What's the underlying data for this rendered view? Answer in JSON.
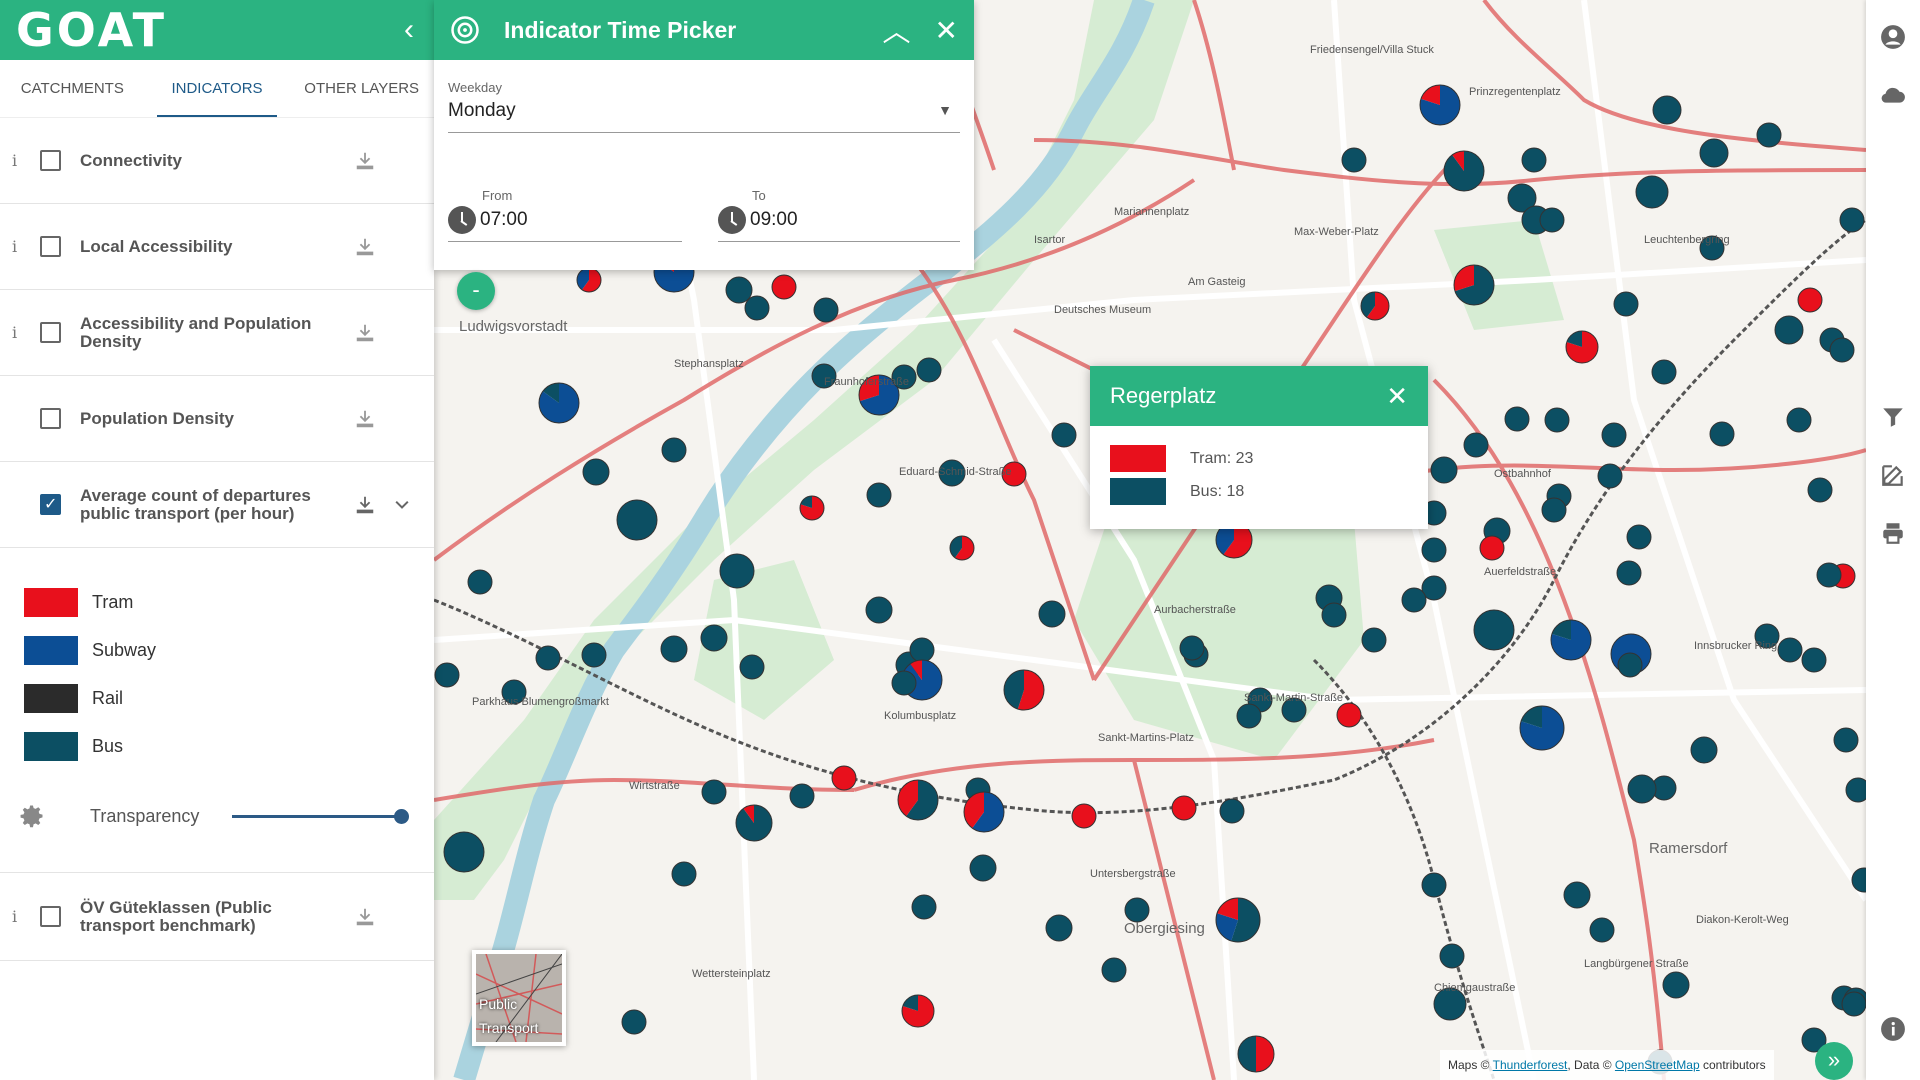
{
  "app": {
    "logo": "GOAT",
    "collapse_icon": "chevron-left-icon"
  },
  "tabs": [
    {
      "label": "CATCHMENTS",
      "active": false
    },
    {
      "label": "INDICATORS",
      "active": true
    },
    {
      "label": "OTHER LAYERS",
      "active": false
    }
  ],
  "layers": [
    {
      "label": "Connectivity",
      "info": "i",
      "checked": false
    },
    {
      "label": "Local Accessibility",
      "info": "i",
      "checked": false
    },
    {
      "label": "Accessibility and Population Density",
      "info": "i",
      "checked": false
    },
    {
      "label": "Population Density",
      "info": "",
      "checked": false
    },
    {
      "label": "Average count of departures public transport (per hour)",
      "info": "",
      "checked": true
    },
    {
      "label": "ÖV Güteklassen (Public transport benchmark)",
      "info": "i",
      "checked": false
    }
  ],
  "legend": {
    "items": [
      {
        "label": "Tram",
        "color": "#e8101c"
      },
      {
        "label": "Subway",
        "color": "#0c4e95"
      },
      {
        "label": "Rail",
        "color": "#2b2b2b"
      },
      {
        "label": "Bus",
        "color": "#0c4f63"
      }
    ],
    "transparency_label": "Transparency",
    "transparency_value": 1.0
  },
  "picker": {
    "title": "Indicator Time Picker",
    "weekday_label": "Weekday",
    "weekday_value": "Monday",
    "from_label": "From",
    "from_value": "07:00",
    "to_label": "To",
    "to_value": "09:00"
  },
  "popup": {
    "title": "Regerplatz",
    "rows": [
      {
        "text": "Tram: 23",
        "color": "#e8101c"
      },
      {
        "text": "Bus: 18",
        "color": "#0c4f63"
      }
    ]
  },
  "basemap": {
    "label": "Public Transport"
  },
  "attribution": {
    "prefix": "Maps ©",
    "link1": "Thunderforest",
    "middle": ", Data ©",
    "link2": "OpenStreetMap",
    "suffix": "contributors"
  },
  "map_labels": [
    "Ludwigsvorstadt",
    "Obergiesing",
    "Ramersdorf",
    "Isartor",
    "Deutsches Museum",
    "Am Gasteig",
    "Eduard-Schmid-Straße",
    "Sankt-Martin-Straße",
    "Sankt-Martins-Platz",
    "Max-Weber-Platz",
    "Friedensengel/Villa Stuck",
    "Prinzregentenplatz",
    "Ostbahnhof",
    "Kolumbusplatz",
    "Stephansplatz",
    "Parkhaus Blumengroßmarkt",
    "Wettersteinplatz",
    "Mariannenplatz",
    "Fraunhoferstraße",
    "Auerfeldstraße",
    "Aurbacherstraße",
    "Innsbrucker Ring",
    "Chiemgaustraße",
    "Langbürgener Straße",
    "Diakon-Kerolt-Weg",
    "Untersbergstraße",
    "Wirtstraße",
    "Leuchtenbergring"
  ]
}
